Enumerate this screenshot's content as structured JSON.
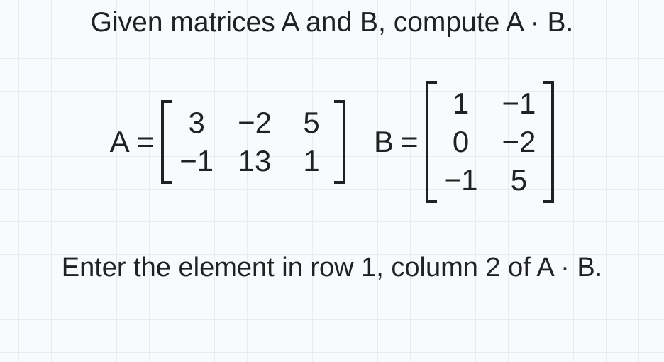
{
  "prompt": "Given matrices A and B, compute A · B.",
  "question": "Enter the element in row 1, column 2 of A · B.",
  "eq": "=",
  "A": {
    "name": "A",
    "rows": [
      [
        "3",
        "−2",
        "5"
      ],
      [
        "−1",
        "13",
        "1"
      ]
    ]
  },
  "B": {
    "name": "B",
    "rows": [
      [
        "1",
        "−1"
      ],
      [
        "0",
        "−2"
      ],
      [
        "−1",
        "5"
      ]
    ]
  }
}
